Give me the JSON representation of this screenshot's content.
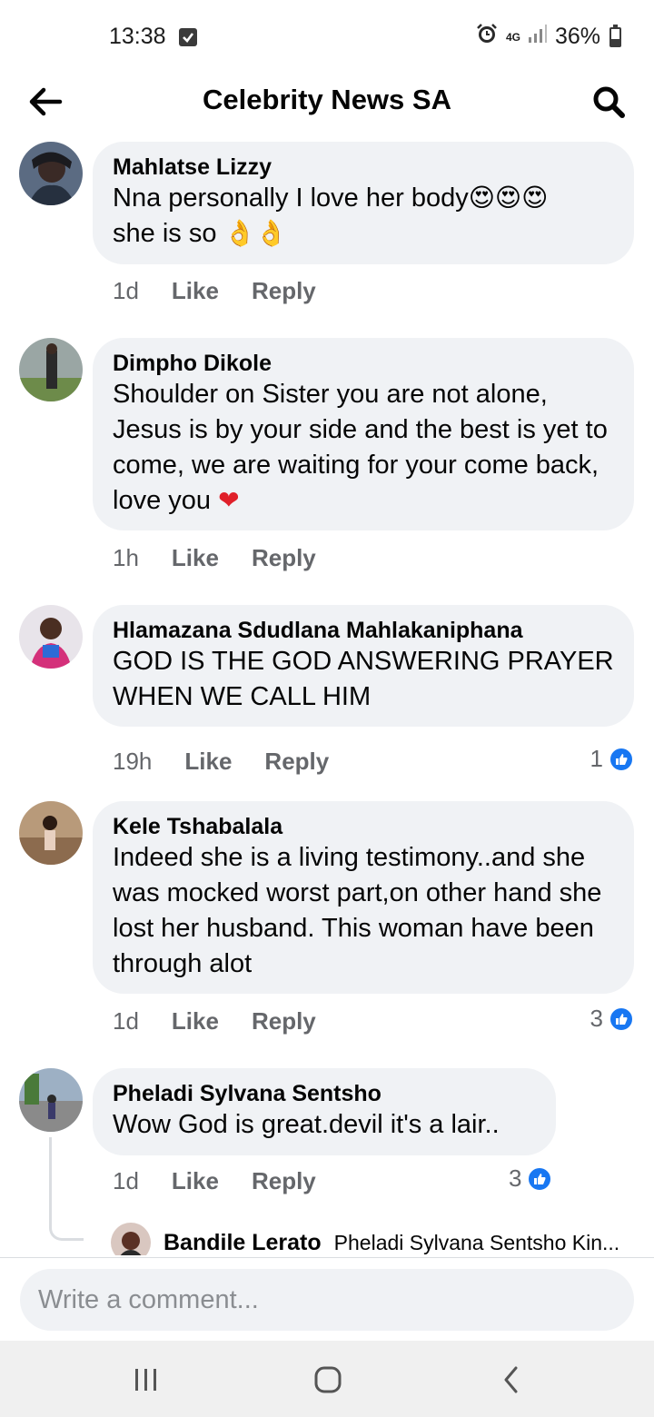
{
  "status_bar": {
    "time": "13:38",
    "network": "4G",
    "battery": "36%",
    "battery_level": 0.36
  },
  "header": {
    "title": "Celebrity News SA",
    "back_icon": "arrow-left-icon",
    "search_icon": "search-icon"
  },
  "comments": [
    {
      "name": "Mahlatse Lizzy",
      "text_line1": "Nna personally I love her body",
      "text_line2": "she is so",
      "time": "1d",
      "like": "Like",
      "reply": "Reply"
    },
    {
      "name": "Dimpho Dikole",
      "text": "Shoulder on Sister you are not alone, Jesus is by your side and the best is yet to come, we are waiting for your come back, love you",
      "time": "1h",
      "like": "Like",
      "reply": "Reply"
    },
    {
      "name": "Hlamazana Sdudlana Mahlakaniphana",
      "text": "GOD IS THE GOD ANSWERING PRAYER WHEN WE CALL HIM",
      "time": "19h",
      "like": "Like",
      "reply": "Reply",
      "reactions": "1"
    },
    {
      "name": "Kele Tshabalala",
      "text": "Indeed she is a living testimony..and she was mocked worst part,on other hand she lost her  husband. This woman have been through alot",
      "time": "1d",
      "like": "Like",
      "reply": "Reply",
      "reactions": "3"
    },
    {
      "name": "Pheladi Sylvana Sentsho",
      "text": "Wow  God is great.devil it's a lair..",
      "time": "1d",
      "like": "Like",
      "reply": "Reply",
      "reactions": "3"
    }
  ],
  "reply_preview": {
    "name": "Bandile Lerato",
    "text": "Pheladi Sylvana Sentsho Kin..."
  },
  "composer": {
    "placeholder": "Write a comment..."
  },
  "colors": {
    "bubble": "#f0f2f5",
    "meta_text": "#65676b",
    "like_blue": "#1877f2"
  }
}
